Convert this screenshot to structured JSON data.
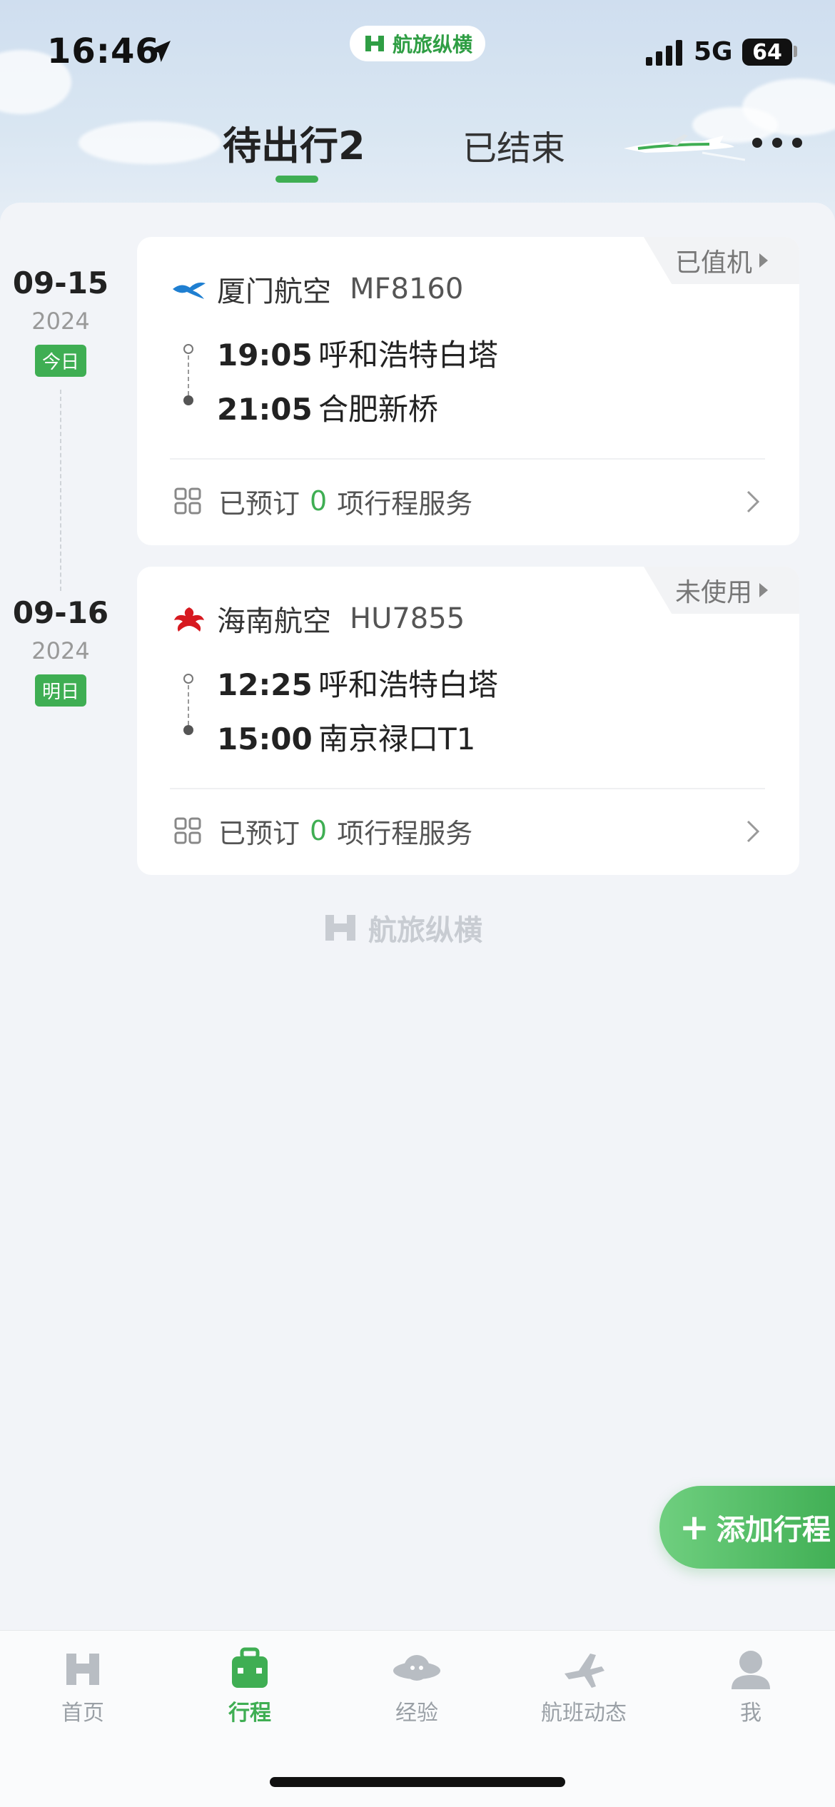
{
  "status_bar": {
    "time": "16:46",
    "brand": "航旅纵横",
    "network": "5G",
    "battery": "64"
  },
  "tabs": {
    "pending": "待出行2",
    "ended": "已结束"
  },
  "trips": [
    {
      "date": "09-15",
      "year": "2024",
      "day_badge": "今日",
      "status": "已值机",
      "airline": "厦门航空",
      "flight_no": "MF8160",
      "depart_time": "19:05",
      "depart_place": "呼和浩特白塔",
      "arrive_time": "21:05",
      "arrive_place": "合肥新桥",
      "service_prefix": "已预订",
      "service_count": "0",
      "service_suffix": "项行程服务"
    },
    {
      "date": "09-16",
      "year": "2024",
      "day_badge": "明日",
      "status": "未使用",
      "airline": "海南航空",
      "flight_no": "HU7855",
      "depart_time": "12:25",
      "depart_place": "呼和浩特白塔",
      "arrive_time": "15:00",
      "arrive_place": "南京禄口T1",
      "service_prefix": "已预订",
      "service_count": "0",
      "service_suffix": "项行程服务"
    }
  ],
  "footer_brand": "航旅纵横",
  "add_button": "添加行程",
  "tabbar": [
    {
      "label": "首页",
      "icon": "home-icon"
    },
    {
      "label": "行程",
      "icon": "itinerary-icon",
      "active": true
    },
    {
      "label": "经验",
      "icon": "experience-icon"
    },
    {
      "label": "航班动态",
      "icon": "flight-status-icon"
    },
    {
      "label": "我",
      "icon": "profile-icon"
    }
  ],
  "colors": {
    "accent": "#3fae53",
    "background": "#f2f4f8",
    "sky": "#cfdeef"
  }
}
